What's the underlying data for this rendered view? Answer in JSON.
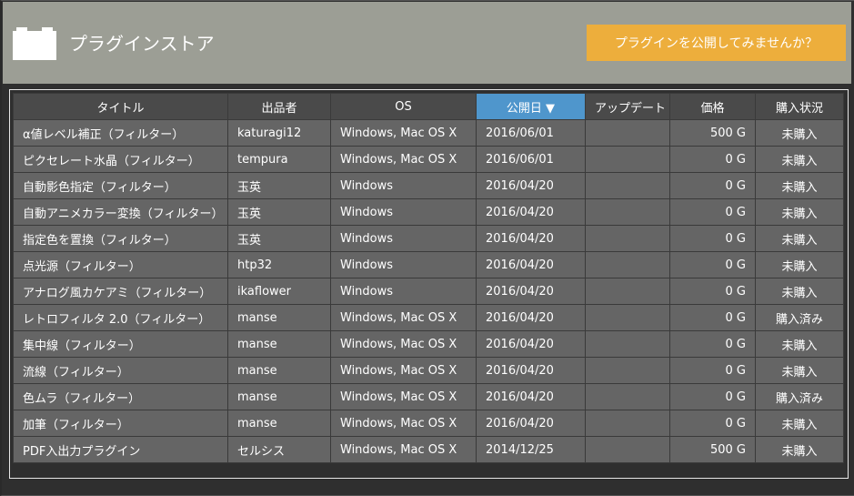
{
  "header": {
    "title": "プラグインストア",
    "cta_label": "プラグインを公開してみませんか？"
  },
  "table": {
    "columns": [
      "タイトル",
      "出品者",
      "OS",
      "公開日 ▼",
      "アップデート",
      "価格",
      "購入状況"
    ],
    "sorted_column": "公開日",
    "rows": [
      {
        "title": "α値レベル補正（フィルター）",
        "author": "katuragi12",
        "os": "Windows, Mac OS X",
        "date": "2016/06/01",
        "update": "",
        "price": "500 G",
        "status": "未購入"
      },
      {
        "title": "ピクセレート水晶（フィルター）",
        "author": "tempura",
        "os": "Windows, Mac OS X",
        "date": "2016/06/01",
        "update": "",
        "price": "0 G",
        "status": "未購入"
      },
      {
        "title": "自動影色指定（フィルター）",
        "author": "玉英",
        "os": "Windows",
        "date": "2016/04/20",
        "update": "",
        "price": "0 G",
        "status": "未購入"
      },
      {
        "title": "自動アニメカラー変換（フィルター）",
        "author": "玉英",
        "os": "Windows",
        "date": "2016/04/20",
        "update": "",
        "price": "0 G",
        "status": "未購入"
      },
      {
        "title": "指定色を置換（フィルター）",
        "author": "玉英",
        "os": "Windows",
        "date": "2016/04/20",
        "update": "",
        "price": "0 G",
        "status": "未購入"
      },
      {
        "title": "点光源（フィルター）",
        "author": "htp32",
        "os": "Windows",
        "date": "2016/04/20",
        "update": "",
        "price": "0 G",
        "status": "未購入"
      },
      {
        "title": "アナログ風カケアミ（フィルター）",
        "author": "ikaflower",
        "os": "Windows",
        "date": "2016/04/20",
        "update": "",
        "price": "0 G",
        "status": "未購入"
      },
      {
        "title": "レトロフィルタ 2.0（フィルター）",
        "author": "manse",
        "os": "Windows, Mac OS X",
        "date": "2016/04/20",
        "update": "",
        "price": "0 G",
        "status": "購入済み"
      },
      {
        "title": "集中線（フィルター）",
        "author": "manse",
        "os": "Windows, Mac OS X",
        "date": "2016/04/20",
        "update": "",
        "price": "0 G",
        "status": "未購入"
      },
      {
        "title": "流線（フィルター）",
        "author": "manse",
        "os": "Windows, Mac OS X",
        "date": "2016/04/20",
        "update": "",
        "price": "0 G",
        "status": "未購入"
      },
      {
        "title": "色ムラ（フィルター）",
        "author": "manse",
        "os": "Windows, Mac OS X",
        "date": "2016/04/20",
        "update": "",
        "price": "0 G",
        "status": "購入済み"
      },
      {
        "title": "加筆（フィルター）",
        "author": "manse",
        "os": "Windows, Mac OS X",
        "date": "2016/04/20",
        "update": "",
        "price": "0 G",
        "status": "未購入"
      },
      {
        "title": "PDF入出力プラグイン",
        "author": "セルシス",
        "os": "Windows, Mac OS X",
        "date": "2014/12/25",
        "update": "",
        "price": "500 G",
        "status": "未購入"
      }
    ]
  },
  "colors": {
    "header_bg": "#9c9e95",
    "cta": "#edae3c",
    "sorted_header": "#4f96cc"
  }
}
